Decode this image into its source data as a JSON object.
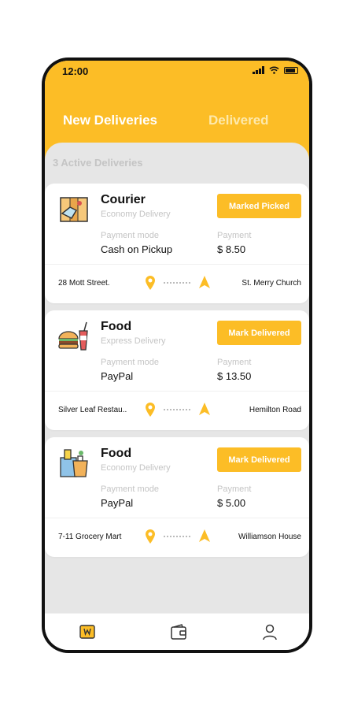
{
  "status_bar": {
    "time": "12:00"
  },
  "tabs": [
    {
      "label": "New Deliveries"
    },
    {
      "label": "Delivered"
    }
  ],
  "section_title": "3 Active Deliveries",
  "deliveries": [
    {
      "title": "Courier",
      "subtitle": "Economy Delivery",
      "action": "Marked Picked",
      "payment_mode_label": "Payment mode",
      "payment_mode": "Cash on Pickup",
      "payment_label": "Payment",
      "payment": "$ 8.50",
      "from": "28 Mott Street.",
      "to": "St. Merry Church",
      "icon": "courier-package-icon"
    },
    {
      "title": "Food",
      "subtitle": "Express Delivery",
      "action": "Mark Delivered",
      "payment_mode_label": "Payment mode",
      "payment_mode": "PayPal",
      "payment_label": "Payment",
      "payment": "$ 13.50",
      "from": "Silver Leaf Restau..",
      "to": "Hemilton Road",
      "icon": "burger-drink-icon"
    },
    {
      "title": "Food",
      "subtitle": "Economy Delivery",
      "action": "Mark Delivered",
      "payment_mode_label": "Payment mode",
      "payment_mode": "PayPal",
      "payment_label": "Payment",
      "payment": "$ 5.00",
      "from": "7-11 Grocery Mart",
      "to": "Williamson House",
      "icon": "grocery-bag-icon"
    }
  ],
  "bottom_nav": [
    "deliveries-icon",
    "wallet-icon",
    "profile-icon"
  ],
  "colors": {
    "accent": "#fcbd26",
    "background": "#e6e6e6"
  }
}
